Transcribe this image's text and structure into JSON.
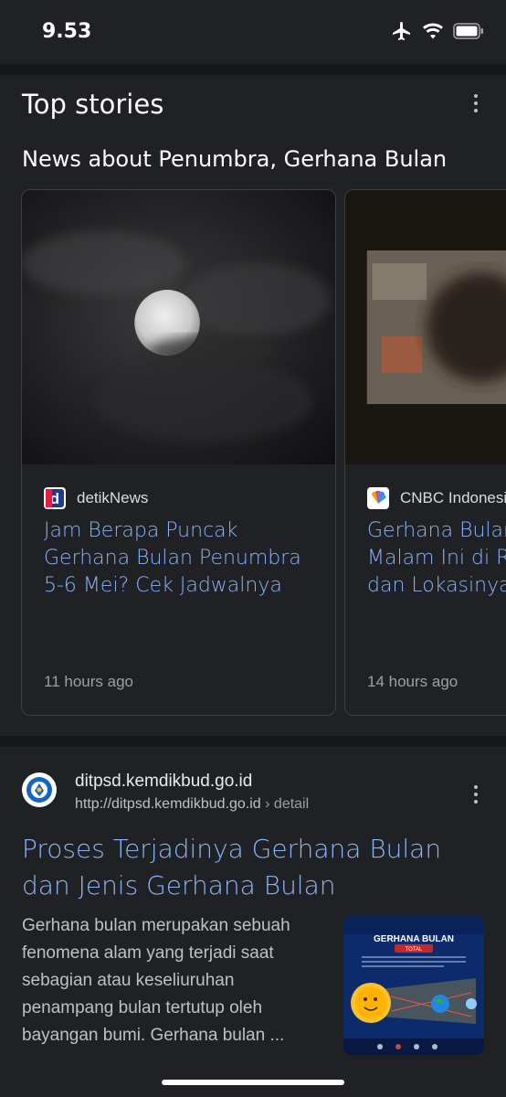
{
  "status_bar": {
    "time": "9.53"
  },
  "top_stories": {
    "title": "Top stories",
    "subtitle": "News about Penumbra, Gerhana Bulan",
    "cards": [
      {
        "source": "detikNews",
        "headline_lines": [
          "Jam Berapa Puncak",
          "Gerhana Bulan Penumbra",
          "5-6 Mei? Cek Jadwalnya"
        ],
        "time": "11 hours ago"
      },
      {
        "source": "CNBC Indonesia",
        "headline_lines": [
          "Gerhana Bulan",
          "Malam Ini di RI",
          "dan Lokasinya"
        ],
        "time": "14 hours ago"
      }
    ]
  },
  "result": {
    "site": "ditpsd.kemdikbud.go.id",
    "url": "http://ditpsd.kemdikbud.go.id",
    "url_path": "› detail",
    "title": "Proses Terjadinya Gerhana Bulan dan Jenis Gerhana Bulan",
    "snippet": "Gerhana bulan merupakan sebuah fenomena alam yang terjadi saat sebagian atau keseliuruhan penampang bulan tertutup oleh bayangan bumi. Gerhana bulan ...",
    "thumbnail": {
      "heading": "GERHANA BULAN",
      "tag": "TOTAL"
    }
  },
  "colors": {
    "background": "#202124",
    "link": "#8ab4f8",
    "text": "#e8eaed",
    "muted": "#9aa0a6"
  }
}
